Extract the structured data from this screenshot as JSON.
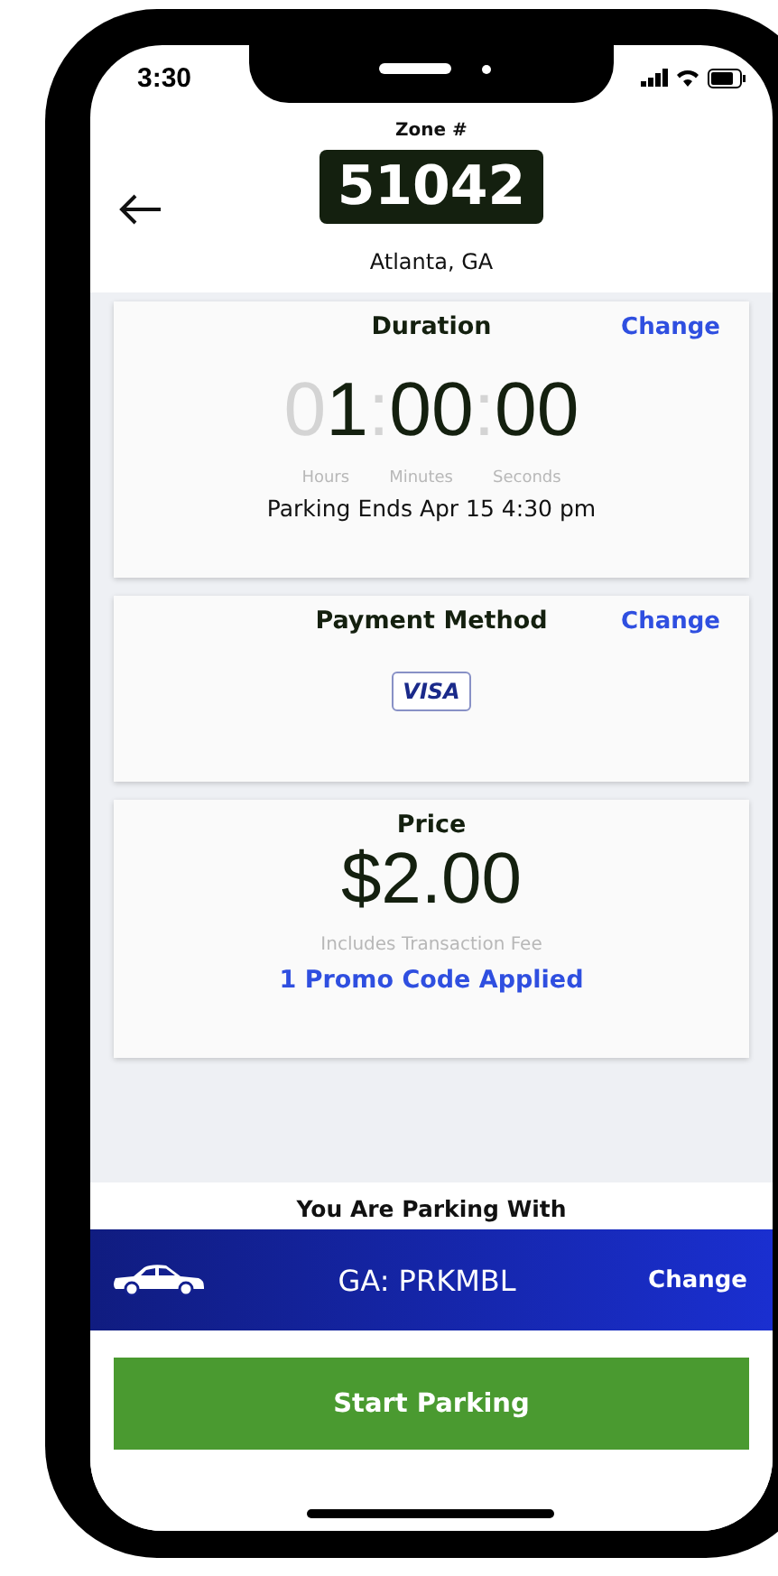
{
  "status_bar": {
    "time": "3:30"
  },
  "header": {
    "zone_label": "Zone #",
    "zone_number": "51042",
    "location": "Atlanta, GA"
  },
  "duration": {
    "title": "Duration",
    "action": "Change",
    "hours": "01",
    "minutes": "00",
    "seconds": "00",
    "separators": [
      ":",
      ":"
    ],
    "unit_labels": [
      "Hours",
      "Minutes",
      "Seconds"
    ],
    "ends": "Parking Ends Apr 15 4:30 pm"
  },
  "payment": {
    "title": "Payment Method",
    "action": "Change",
    "card_brand": "VISA"
  },
  "price": {
    "title": "Price",
    "amount": "$2.00",
    "note": "Includes Transaction Fee",
    "promo": "1 Promo Code Applied"
  },
  "vehicle": {
    "heading": "You Are Parking With",
    "plate": "GA: PRKMBL",
    "action": "Change"
  },
  "primary_button": "Start Parking"
}
